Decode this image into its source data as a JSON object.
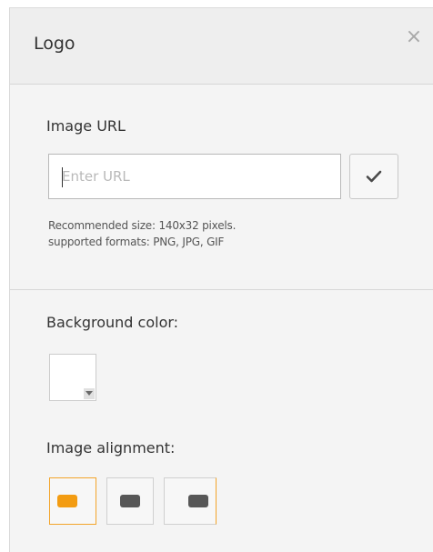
{
  "dialog": {
    "title": "Logo",
    "close_label": "×"
  },
  "image_url": {
    "label": "Image URL",
    "placeholder": "Enter URL",
    "value": "",
    "confirm_icon": "checkmark-icon",
    "hint_line1": "Recommended size: 140x32 pixels.",
    "hint_line2": "supported formats: PNG, JPG, GIF"
  },
  "background_color": {
    "label": "Background color:",
    "value": "#ffffff",
    "dropdown_icon": "caret-down-icon"
  },
  "image_alignment": {
    "label": "Image alignment:",
    "options": [
      "left",
      "center",
      "right"
    ],
    "selected": "left",
    "accent_color": "#f39c12"
  }
}
